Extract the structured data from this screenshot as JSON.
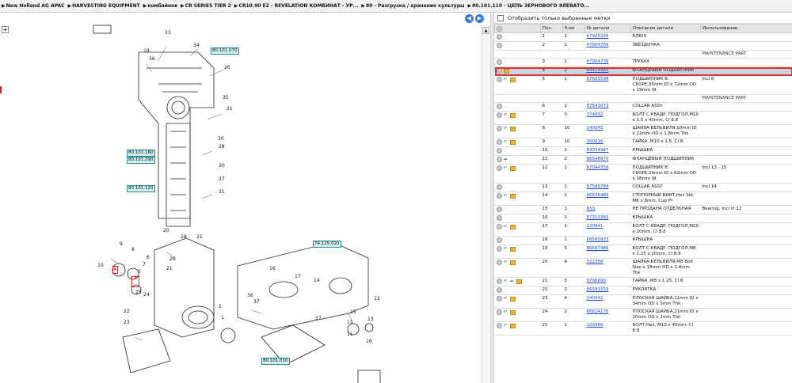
{
  "breadcrumb": [
    "New Holland AG APAC",
    "HARVESTING EQUIPMENT",
    "комбайнов",
    "CR SERIES TIER 2",
    "CR10.90 E2 - REVELATION КОМБИНАТ - УР...",
    "80 - Разгрузка / хранение культуры",
    "80.101.110 - ЦЕПЬ ЗЕРНОВОГО ЭЛЕВАТО..."
  ],
  "nav": {
    "back": "◀",
    "forward": "▶"
  },
  "filter_label": "Отобразить только выбранные метки",
  "columns": [
    "Поз.",
    "К-во",
    "№ детали",
    "Описание детали",
    "Использование"
  ],
  "rows": [
    {
      "pos": "1",
      "qty": "1",
      "part": "47925226",
      "desc": "КЛЮЧ",
      "use": "",
      "icons": "o"
    },
    {
      "pos": "2",
      "qty": "1",
      "part": "47904756",
      "desc": "ЗВЕЗДОЧКА",
      "use": "",
      "icons": "o"
    },
    {
      "section": "MAINTENANCE PART"
    },
    {
      "pos": "3",
      "qty": "1",
      "part": "47904739",
      "desc": "ТРУБКА",
      "use": "",
      "icons": "o"
    },
    {
      "pos": "4",
      "qty": "2",
      "part": "84414985",
      "desc": "ФЛАНЦЕВЫЙ ПОДШИПНИК",
      "use": "",
      "icons": "ob",
      "selected": true
    },
    {
      "pos": "5",
      "qty": "1",
      "part": "87605598",
      "desc": "ПОДШИПНИК В СБОРЕ,35mm ID x 72mm OD x 19mm W",
      "use": "Incl 6",
      "icons": "oab"
    },
    {
      "section": "MAINTENANCE PART"
    },
    {
      "pos": "6",
      "qty": "1",
      "part": "87643073",
      "desc": "COLLAR ASSY.",
      "use": "",
      "icons": "o"
    },
    {
      "pos": "7",
      "qty": "3",
      "part": "374892",
      "desc": "БОЛТ С КВАДР. ПОДГОЛ,M10 x 1.5 x 40mm, Cl 8.8",
      "use": "",
      "icons": "oab"
    },
    {
      "pos": "8",
      "qty": "10",
      "part": "140045",
      "desc": "ШАЙБА БЕЛЬВИЛЯ,10mm ID x 22mm OD x 1.8mm Thk",
      "use": "",
      "icons": "oab"
    },
    {
      "pos": "9",
      "qty": "10",
      "part": "100016",
      "desc": "ГАЙКА ,M10 x 1.5, Cl 8",
      "use": "",
      "icons": "oab"
    },
    {
      "pos": "10",
      "qty": "1",
      "part": "84334947",
      "desc": "КРЫШКА",
      "use": "",
      "icons": "o"
    },
    {
      "pos": "11",
      "qty": "2",
      "part": "86548970",
      "desc": "ФЛАНЦЕВЫЙ ПОДШИПНИК",
      "use": "",
      "icons": "og"
    },
    {
      "pos": "12",
      "qty": "1",
      "part": "87044358",
      "desc": "ПОДШИПНИК В СБОРЕ,30mm ID x 62mm OD x 18mm W",
      "use": "Incl 13 - 15",
      "icons": "oab"
    },
    {
      "pos": "13",
      "qty": "1",
      "part": "87586784",
      "desc": "COLLAR ASSY.",
      "use": "Incl 14",
      "icons": "o"
    },
    {
      "pos": "14",
      "qty": "1",
      "part": "86636489",
      "desc": "СТОПОРНЫЙ ВИНТ,Hex Skt, M8 x 8mm, Cup Pt",
      "use": "",
      "icons": "oab"
    },
    {
      "pos": "15",
      "qty": "1",
      "part": "NSS",
      "desc": "НЕ ПРОДАНА ОТДЕЛЬНАЯ",
      "use": "Bearing, Incl in 12",
      "icons": "o"
    },
    {
      "pos": "16",
      "qty": "1",
      "part": "87313383",
      "desc": "КРЫШКА",
      "use": "",
      "icons": "o"
    },
    {
      "pos": "17",
      "qty": "1",
      "part": "120841",
      "desc": "БОЛТ С КВАДР. ПОДГОЛ,M10 x 20mm, Cl 8.8",
      "use": "",
      "icons": "oab"
    },
    {
      "pos": "18",
      "qty": "1",
      "part": "86580933",
      "desc": "КРЫШКА",
      "use": "",
      "icons": "o"
    },
    {
      "pos": "19",
      "qty": "5",
      "part": "86587486",
      "desc": "БОЛТ С КВАДР. ПОДГОЛ,M8 x 1.25 x 20mm, Cl 8.8",
      "use": "",
      "icons": "oab"
    },
    {
      "pos": "20",
      "qty": "4",
      "part": "322358",
      "desc": "ШАЙБА БЕЛЬВИЛЯ,M8 Bolt Size x 18mm OD x 1.4mm Thk",
      "use": "",
      "icons": "oab"
    },
    {
      "pos": "21",
      "qty": "5",
      "part": "9706690",
      "desc": "ГАЙКА ,M8 x 1.25, Cl 8",
      "use": "",
      "icons": "oagb"
    },
    {
      "pos": "22",
      "qty": "1",
      "part": "86581559",
      "desc": "РУКОЯТКА",
      "use": "",
      "icons": "o"
    },
    {
      "pos": "23",
      "qty": "4",
      "part": "140042",
      "desc": "ПЛОСКАЯ ШАЙБА,11mm ID x 34mm OD x 3mm Thk",
      "use": "",
      "icons": "oab"
    },
    {
      "pos": "24",
      "qty": "2",
      "part": "86624176",
      "desc": "ПЛОСКАЯ ШАЙБА,11mm ID x 20mm OD x 2mm Thk",
      "use": "",
      "icons": "oab"
    },
    {
      "pos": "25",
      "qty": "1",
      "part": "120968",
      "desc": "БОЛТ,Hex, M10 x 40mm, Cl 8.8",
      "use": "",
      "icons": "oab"
    }
  ],
  "diagram": {
    "tags": [
      "80.101.070",
      "80.101.160",
      "80.101.290",
      "80.101.120",
      "74.125.020",
      "80.101.010"
    ],
    "labels": [
      "33",
      "19",
      "34",
      "36",
      "26",
      "35",
      "21",
      "30",
      "28",
      "30",
      "27",
      "31",
      "20",
      "18",
      "21",
      "29",
      "9",
      "8",
      "6",
      "7",
      "5",
      "21",
      "10",
      "4",
      "3",
      "24",
      "25",
      "22",
      "23",
      "36",
      "37",
      "2",
      "1",
      "16",
      "17",
      "14",
      "37",
      "15",
      "11",
      "12",
      "13",
      "11",
      "16"
    ]
  }
}
